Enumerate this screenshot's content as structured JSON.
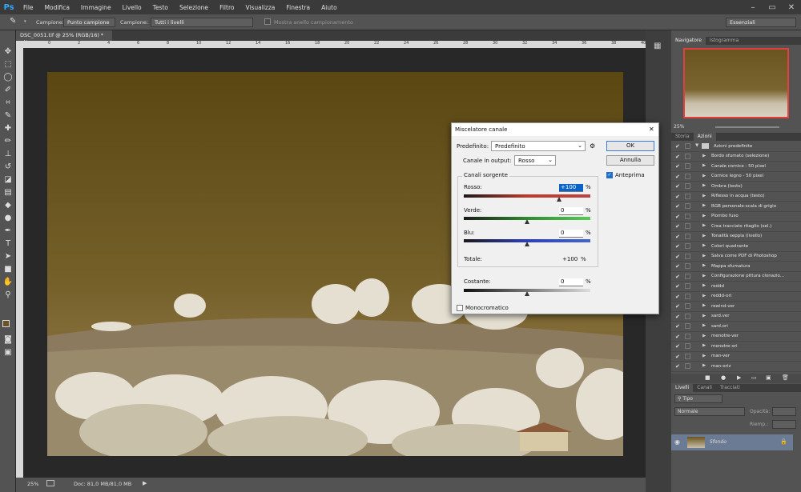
{
  "app": {
    "logo": "Ps"
  },
  "menu": [
    "File",
    "Modifica",
    "Immagine",
    "Livello",
    "Testo",
    "Selezione",
    "Filtro",
    "Visualizza",
    "Finestra",
    "Aiuto"
  ],
  "window_controls": [
    "–",
    "▭",
    "✕"
  ],
  "options_bar": {
    "sample_label": "Campione:",
    "sample_value": "Punto campione",
    "sample2_label": "Campione:",
    "sample2_value": "Tutti i livelli",
    "ring_label": "Mostra anello campionamento",
    "workspace": "Essenziali"
  },
  "document": {
    "tab_title": "DSC_0051.tif @ 25% (RGB/16) *",
    "close": "×"
  },
  "ruler_h_labels": [
    "0",
    "2",
    "4",
    "6",
    "8",
    "10",
    "12",
    "14",
    "16",
    "18",
    "20",
    "22",
    "24",
    "26",
    "28",
    "30",
    "32",
    "34",
    "36",
    "38",
    "40"
  ],
  "status": {
    "zoom": "25%",
    "doc_info": "Doc: 81,0 MB/81,0 MB"
  },
  "navigator": {
    "tabs": [
      "Navigatore",
      "Istogramma"
    ],
    "zoom": "25%"
  },
  "history_tabs": [
    "Storia",
    "Azioni"
  ],
  "actions": {
    "set_name": "Azioni predefinite",
    "items": [
      "Bordo sfumato (selezione)",
      "Canale cornice - 50 pixel",
      "Cornice legno - 50 pixel",
      "Ombra (testo)",
      "Riflesso in acqua (testo)",
      "RGB personale-scala di grigio",
      "Piombo fuso",
      "Crea tracciato ritaglio (sel.)",
      "Tonalità seppia (livello)",
      "Colori quadrante",
      "Salva come PDF di Photoshop",
      "Mappa sfumatura",
      "Configurazione pittura clonazio...",
      "reddd",
      "reddd-ori",
      "rewind-ver",
      "sard.ver",
      "sard.ori",
      "menotre-ver",
      "menotre-ori",
      "man-ver",
      "man-oriz"
    ]
  },
  "layers": {
    "tabs": [
      "Livelli",
      "Canali",
      "Tracciati"
    ],
    "filter": "Tipo",
    "blend_mode": "Normale",
    "opacity_label": "Opacità:",
    "fill_label": "Riemp.:",
    "layer_name": "Sfondo"
  },
  "dialog": {
    "title": "Miscelatore canale",
    "close": "✕",
    "preset_label": "Predefinito:",
    "preset_value": "Predefinito",
    "ok": "OK",
    "cancel": "Annulla",
    "output_label": "Canale in output:",
    "output_value": "Rosso",
    "preview_label": "Anteprima",
    "group_label": "Canali sorgente",
    "red_label": "Rosso:",
    "red_value": "+100",
    "green_label": "Verde:",
    "green_value": "0",
    "blue_label": "Blu:",
    "blue_value": "0",
    "total_label": "Totale:",
    "total_value": "+100",
    "pct": "%",
    "constant_label": "Costante:",
    "constant_value": "0",
    "mono_label": "Monocromatico",
    "levels": {
      "red": 100,
      "green": 0,
      "blue": 0,
      "constant": 0
    }
  },
  "colors": {
    "accent": "#31a8ff",
    "nav_frame": "#e0413c",
    "selection": "#0a64c8"
  }
}
